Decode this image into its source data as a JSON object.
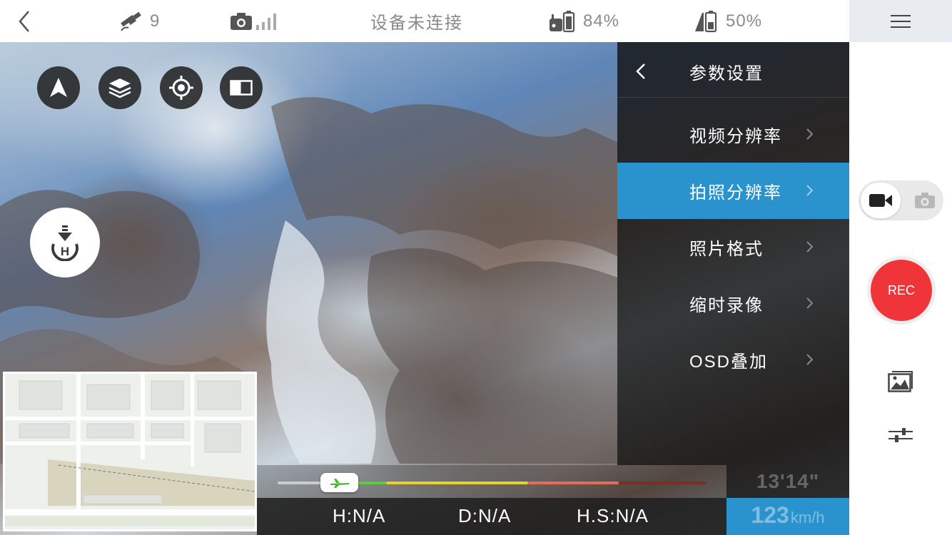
{
  "topbar": {
    "satellite_count": "9",
    "connection_status": "设备未连接",
    "remote_battery": "84%",
    "drone_battery": "50%"
  },
  "panel": {
    "title": "参数设置",
    "items": [
      {
        "label": "视频分辨率",
        "active": false
      },
      {
        "label": "拍照分辨率",
        "active": true
      },
      {
        "label": "照片格式",
        "active": false
      },
      {
        "label": "缩时录像",
        "active": false
      },
      {
        "label": "OSD叠加",
        "active": false
      }
    ]
  },
  "telemetry": {
    "height": "H:N/A",
    "distance": "D:N/A",
    "horizontal_speed": "H.S:N/A",
    "flight_time": "13'14\"",
    "speed_value": "123",
    "speed_unit": "km/h"
  },
  "controls": {
    "rec_label": "REC"
  },
  "colors": {
    "accent": "#2a92cc",
    "rec": "#f0353a"
  }
}
